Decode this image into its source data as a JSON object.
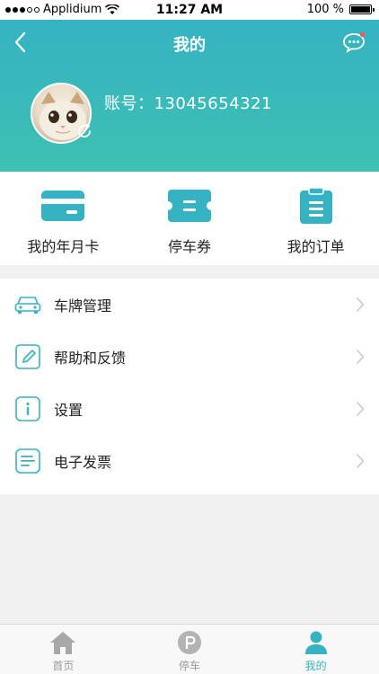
{
  "status_bar": {
    "carrier": "Applidium",
    "time": "11:27 AM",
    "battery": "100 %"
  },
  "header": {
    "title": "我的",
    "account": "账号：13045654321"
  },
  "quick_actions": [
    {
      "label": "我的年月卡",
      "icon": "card-icon"
    },
    {
      "label": "停车券",
      "icon": "ticket-icon"
    },
    {
      "label": "我的订单",
      "icon": "order-icon"
    }
  ],
  "menu": [
    {
      "label": "车牌管理",
      "icon": "car-icon"
    },
    {
      "label": "帮助和反馈",
      "icon": "edit-icon"
    },
    {
      "label": "设置",
      "icon": "info-icon"
    },
    {
      "label": "电子发票",
      "icon": "invoice-icon"
    }
  ],
  "tabbar": [
    {
      "label": "首页",
      "icon": "home-icon",
      "active": false
    },
    {
      "label": "停车",
      "icon": "parking-icon",
      "active": false
    },
    {
      "label": "我的",
      "icon": "user-icon",
      "active": true
    }
  ],
  "colors": {
    "accent": "#35b3c2",
    "header_gradient_end": "#3ec0b3",
    "notification_dot": "#ff5a3c"
  }
}
